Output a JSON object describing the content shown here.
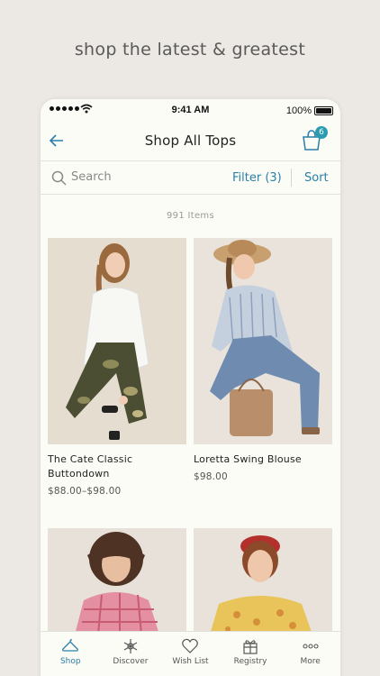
{
  "tagline": "shop the latest & greatest",
  "status": {
    "time": "9:41 AM",
    "battery": "100%"
  },
  "nav": {
    "title": "Shop All Tops",
    "bag_count": "6"
  },
  "toolbar": {
    "search_placeholder": "Search",
    "filter_label": "Filter (3)",
    "sort_label": "Sort"
  },
  "results": {
    "count_label": "991 Items"
  },
  "products": [
    {
      "name": "The Cate Classic Buttondown",
      "price": "$88.00–$98.00"
    },
    {
      "name": "Loretta Swing Blouse",
      "price": "$98.00"
    },
    {
      "name": "",
      "price": ""
    },
    {
      "name": "",
      "price": ""
    }
  ],
  "tabs": [
    {
      "label": "Shop",
      "icon": "hanger-icon",
      "active": true
    },
    {
      "label": "Discover",
      "icon": "snowflake-icon",
      "active": false
    },
    {
      "label": "Wish List",
      "icon": "heart-icon",
      "active": false
    },
    {
      "label": "Registry",
      "icon": "gift-icon",
      "active": false
    },
    {
      "label": "More",
      "icon": "more-icon",
      "active": false
    }
  ],
  "colors": {
    "accent": "#2a7fa8",
    "badge": "#2a9bb0",
    "background": "#ece8e3"
  }
}
